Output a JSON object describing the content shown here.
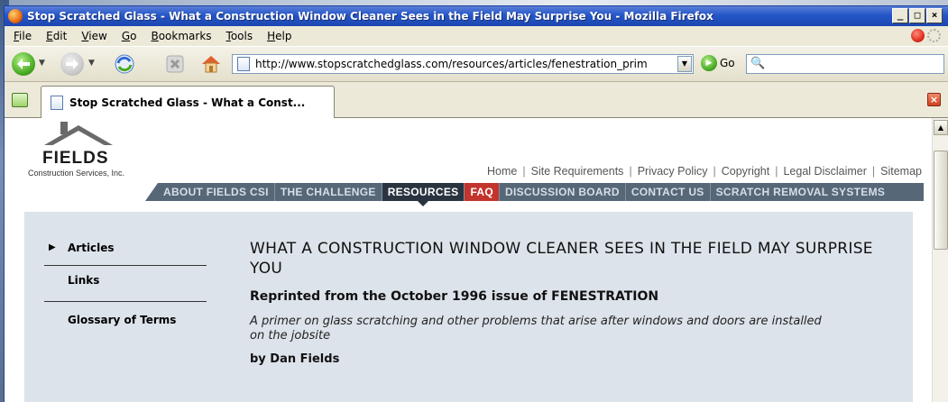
{
  "window": {
    "title": "Stop Scratched Glass - What a Construction Window Cleaner Sees in the Field May Surprise You - Mozilla Firefox",
    "min": "_",
    "max": "□",
    "close": "×"
  },
  "menu": [
    {
      "ul": "F",
      "rest": "ile"
    },
    {
      "ul": "E",
      "rest": "dit"
    },
    {
      "ul": "V",
      "rest": "iew"
    },
    {
      "ul": "G",
      "rest": "o"
    },
    {
      "ul": "B",
      "rest": "ookmarks"
    },
    {
      "ul": "T",
      "rest": "ools"
    },
    {
      "ul": "H",
      "rest": "elp"
    }
  ],
  "toolbar": {
    "url": "http://www.stopscratchedglass.com/resources/articles/fenestration_prim",
    "go_label": "Go",
    "search_glyph": "🔍"
  },
  "tab": {
    "title": "Stop Scratched Glass - What a Const..."
  },
  "site": {
    "logo_word": "FIELDS",
    "logo_sub": "Construction Services, Inc.",
    "util_links": [
      "Home",
      "Site Requirements",
      "Privacy Policy",
      "Copyright",
      "Legal Disclaimer",
      "Sitemap"
    ],
    "util_sep": "|",
    "nav": [
      "ABOUT FIELDS CSI",
      "THE CHALLENGE",
      "RESOURCES",
      "FAQ",
      "DISCUSSION BOARD",
      "CONTACT US",
      "SCRATCH REMOVAL SYSTEMS"
    ],
    "sidebar": [
      "Articles",
      "Links",
      "Glossary of Terms"
    ],
    "sidebar_arrow": "▶",
    "article": {
      "title": "WHAT A CONSTRUCTION WINDOW CLEANER SEES IN THE FIELD MAY SURPRISE YOU",
      "subtitle": "Reprinted from the October 1996 issue of FENESTRATION",
      "lede": "A primer on glass scratching and other problems that arise after windows and doors are installed on the jobsite",
      "byline": "by Dan Fields"
    }
  }
}
